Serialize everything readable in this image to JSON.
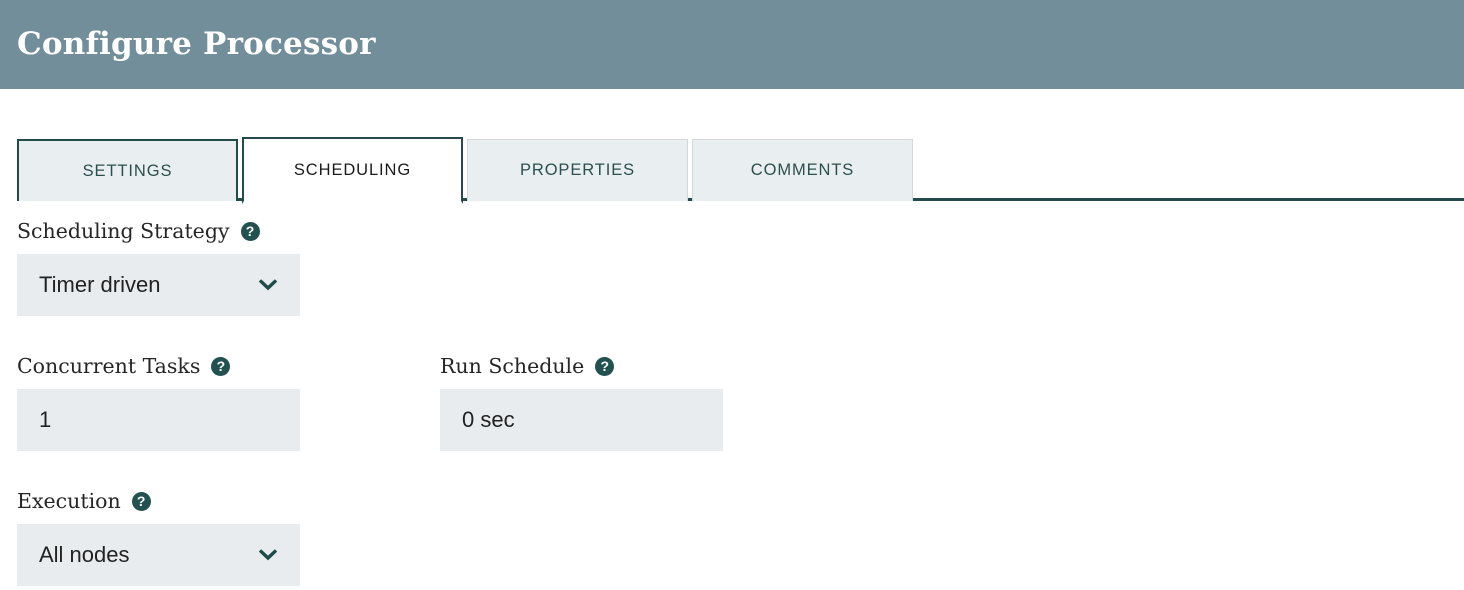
{
  "dialog": {
    "title": "Configure Processor"
  },
  "colors": {
    "header_bg": "#728e9b",
    "accent_dark_teal": "#254a4c",
    "field_bg": "#e8ecef",
    "tab_inactive_bg": "#e9eef0",
    "tab_active_bg": "#ffffff",
    "help_icon_bg": "#23514f"
  },
  "tabs": [
    {
      "label": "SETTINGS",
      "active": false,
      "name": "tab-settings"
    },
    {
      "label": "SCHEDULING",
      "active": true,
      "name": "tab-scheduling"
    },
    {
      "label": "PROPERTIES",
      "active": false,
      "name": "tab-properties"
    },
    {
      "label": "COMMENTS",
      "active": false,
      "name": "tab-comments"
    }
  ],
  "icons": {
    "help": "?",
    "chevron_down": "chevron-down-icon"
  },
  "form": {
    "scheduling_strategy": {
      "label": "Scheduling Strategy",
      "help": "?",
      "value": "Timer driven",
      "type": "select"
    },
    "concurrent_tasks": {
      "label": "Concurrent Tasks",
      "help": "?",
      "value": "1",
      "placeholder": "",
      "type": "input"
    },
    "run_schedule": {
      "label": "Run Schedule",
      "help": "?",
      "value": "0 sec",
      "placeholder": "",
      "type": "input"
    },
    "execution": {
      "label": "Execution",
      "help": "?",
      "value": "All nodes",
      "type": "select"
    }
  }
}
